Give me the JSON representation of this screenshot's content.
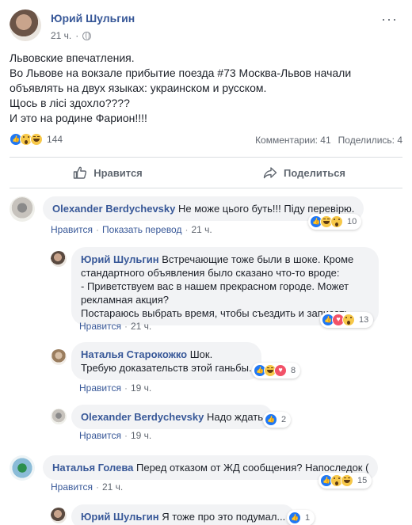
{
  "post": {
    "author": "Юрий Шульгин",
    "time": "21 ч.",
    "lines": [
      "Львовские впечатления.",
      "Во Львове на вокзале прибытие поезда #73 Москва-Львов начали",
      "объявлять на двух языках: украинском и русском.",
      "Щось в лісі здохло????",
      "И это на родине Фарион!!!!"
    ],
    "reaction_count": "144",
    "reaction_icons": [
      "like-icon",
      "wow-icon",
      "haha-icon"
    ],
    "comments_link": "Комментарии: 41",
    "shares_link": "Поделились: 4"
  },
  "actions": {
    "like": "Нравится",
    "share": "Поделиться"
  },
  "comments": [
    {
      "author": "Olexander Berdychevsky",
      "lines": [
        "Не може цього буть!!! Піду перевірю."
      ],
      "like": "Нравится",
      "translate": "Показать перевод",
      "time": "21 ч.",
      "reactions": "10"
    },
    {
      "author": "Юрий Шульгин",
      "lines": [
        "Встречающие тоже были в шоке. Кроме",
        "стандартного объявления было сказано что-то вроде:",
        "- Приветствуем вас в нашем прекрасном городе. Может",
        "рекламная акция?",
        "Постараюсь выбрать время, чтобы съездить и записать."
      ],
      "like": "Нравится",
      "time": "21 ч.",
      "reactions": "13"
    },
    {
      "author": "Наталья Старокожко",
      "lines": [
        "Шок.",
        "Требую доказательств этой ганьбы."
      ],
      "like": "Нравится",
      "time": "19 ч.",
      "reactions": "8"
    },
    {
      "author": "Olexander Berdychevsky",
      "lines": [
        "Надо ждать"
      ],
      "like": "Нравится",
      "time": "19 ч.",
      "reactions": "2"
    },
    {
      "author": "Наталья Голева",
      "lines": [
        "Перед отказом от ЖД сообщения? Напоследок ("
      ],
      "like": "Нравится",
      "time": "21 ч.",
      "reactions": "15"
    },
    {
      "author": "Юрий Шульгин",
      "lines": [
        "Я тоже про это подумал..."
      ],
      "reactions": "1"
    }
  ],
  "sep": "·"
}
